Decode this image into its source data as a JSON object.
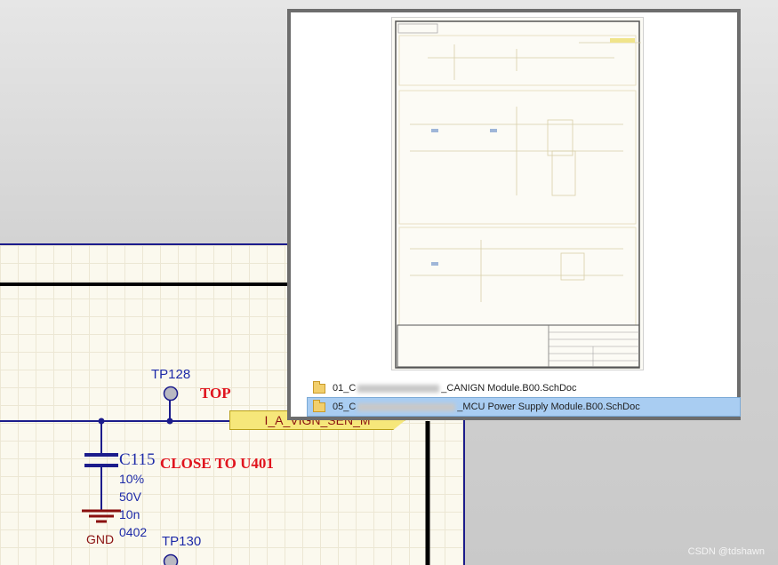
{
  "schematic": {
    "test_points": [
      {
        "name": "TP128"
      },
      {
        "name": "TP130"
      }
    ],
    "notes": {
      "top": "TOP",
      "close_to": "CLOSE TO U401"
    },
    "net_port": "I_A_VIGN_SEN_M",
    "capacitor": {
      "designator": "C115",
      "tolerance": "10%",
      "voltage": "50V",
      "value": "10n",
      "package": "0402"
    },
    "ground_label": "GND",
    "colors": {
      "wire": "#1c1c8c",
      "note": "#e0141e",
      "port_fill": "#f6e77a",
      "sheet_bg": "#fbf9ee"
    }
  },
  "preview": {
    "files": [
      {
        "prefix": "01_C",
        "suffix": "_CANIGN Module.B00.SchDoc",
        "selected": false,
        "icon": "schdoc-folder-icon"
      },
      {
        "prefix": "05_C",
        "suffix": "_MCU Power Supply Module.B00.SchDoc",
        "selected": true,
        "icon": "schdoc-folder-icon"
      }
    ]
  },
  "watermark": "CSDN @tdshawn"
}
